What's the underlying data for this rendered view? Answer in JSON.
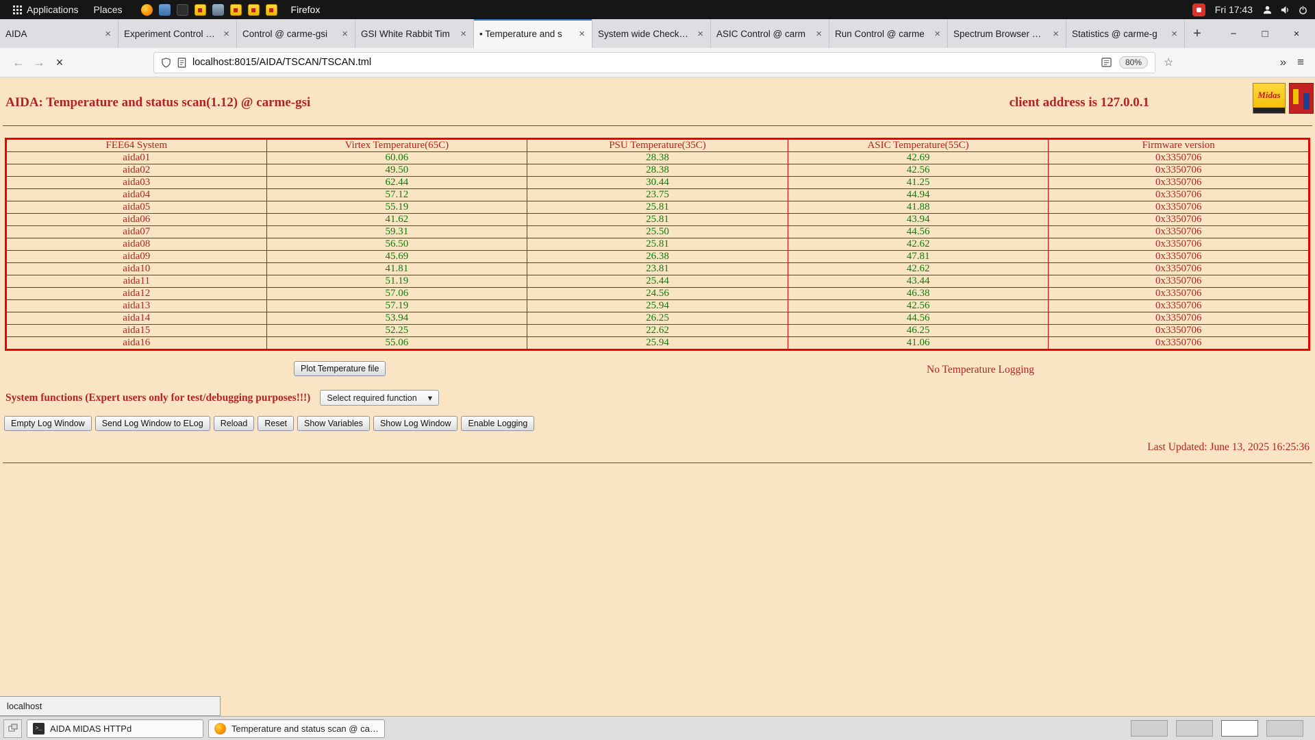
{
  "glyphs": {
    "close": "×",
    "new_tab": "+",
    "back": "←",
    "forward": "→",
    "stop": "×",
    "overflow": "»",
    "menu": "≡",
    "star": "☆",
    "minimize": "−",
    "maximize": "□",
    "window_close": "×",
    "dropdown_arrow": "▾",
    "terminal_prompt": ">_"
  },
  "topbar": {
    "applications_label": "Applications",
    "places_label": "Places",
    "app_title": "Firefox",
    "clock": "Fri 17:43"
  },
  "browser": {
    "tabs": [
      {
        "label": "AIDA"
      },
      {
        "label": "Experiment Control @ c"
      },
      {
        "label": "Control @ carme-gsi"
      },
      {
        "label": "GSI White Rabbit Tim"
      },
      {
        "label": "• Temperature and s",
        "active": true
      },
      {
        "label": "System wide Checks @"
      },
      {
        "label": "ASIC Control @ carm"
      },
      {
        "label": "Run Control @ carme"
      },
      {
        "label": "Spectrum Browser @ c"
      },
      {
        "label": "Statistics @ carme-g"
      }
    ],
    "url": "localhost:8015/AIDA/TSCAN/TSCAN.tml",
    "zoom_level": "80%"
  },
  "page": {
    "title": "AIDA: Temperature and status scan(1.12) @ carme-gsi",
    "client_address": "client address is 127.0.0.1",
    "logo_midas_text": "Midas",
    "table": {
      "headers": [
        "FEE64 System",
        "Virtex Temperature(65C)",
        "PSU Temperature(35C)",
        "ASIC Temperature(55C)",
        "Firmware version"
      ],
      "rows": [
        {
          "system": "aida01",
          "virtex": "60.06",
          "psu": "28.38",
          "asic": "42.69",
          "firmware": "0x3350706"
        },
        {
          "system": "aida02",
          "virtex": "49.50",
          "psu": "28.38",
          "asic": "42.56",
          "firmware": "0x3350706"
        },
        {
          "system": "aida03",
          "virtex": "62.44",
          "psu": "30.44",
          "asic": "41.25",
          "firmware": "0x3350706"
        },
        {
          "system": "aida04",
          "virtex": "57.12",
          "psu": "23.75",
          "asic": "44.94",
          "firmware": "0x3350706"
        },
        {
          "system": "aida05",
          "virtex": "55.19",
          "psu": "25.81",
          "asic": "41.88",
          "firmware": "0x3350706"
        },
        {
          "system": "aida06",
          "virtex": "41.62",
          "psu": "25.81",
          "asic": "43.94",
          "firmware": "0x3350706"
        },
        {
          "system": "aida07",
          "virtex": "59.31",
          "psu": "25.50",
          "asic": "44.56",
          "firmware": "0x3350706"
        },
        {
          "system": "aida08",
          "virtex": "56.50",
          "psu": "25.81",
          "asic": "42.62",
          "firmware": "0x3350706"
        },
        {
          "system": "aida09",
          "virtex": "45.69",
          "psu": "26.38",
          "asic": "47.81",
          "firmware": "0x3350706"
        },
        {
          "system": "aida10",
          "virtex": "41.81",
          "psu": "23.81",
          "asic": "42.62",
          "firmware": "0x3350706"
        },
        {
          "system": "aida11",
          "virtex": "51.19",
          "psu": "25.44",
          "asic": "43.44",
          "firmware": "0x3350706"
        },
        {
          "system": "aida12",
          "virtex": "57.06",
          "psu": "24.56",
          "asic": "46.38",
          "firmware": "0x3350706"
        },
        {
          "system": "aida13",
          "virtex": "57.19",
          "psu": "25.94",
          "asic": "42.56",
          "firmware": "0x3350706"
        },
        {
          "system": "aida14",
          "virtex": "53.94",
          "psu": "26.25",
          "asic": "44.56",
          "firmware": "0x3350706"
        },
        {
          "system": "aida15",
          "virtex": "52.25",
          "psu": "22.62",
          "asic": "46.25",
          "firmware": "0x3350706"
        },
        {
          "system": "aida16",
          "virtex": "55.06",
          "psu": "25.94",
          "asic": "41.06",
          "firmware": "0x3350706"
        }
      ]
    },
    "plot_button_label": "Plot Temperature file",
    "no_logging_text": "No Temperature Logging",
    "system_functions_label": "System functions (Expert users only for test/debugging purposes!!!)",
    "function_select_value": "Select required function",
    "action_buttons": [
      "Empty Log Window",
      "Send Log Window to ELog",
      "Reload",
      "Reset",
      "Show Variables",
      "Show Log Window",
      "Enable Logging"
    ],
    "last_updated": "Last Updated: June 13, 2025 16:25:36"
  },
  "status_tooltip": "localhost",
  "taskbar": {
    "tasks": [
      {
        "label": "AIDA MIDAS HTTPd"
      },
      {
        "label": "Temperature and status scan @ car..."
      }
    ]
  }
}
